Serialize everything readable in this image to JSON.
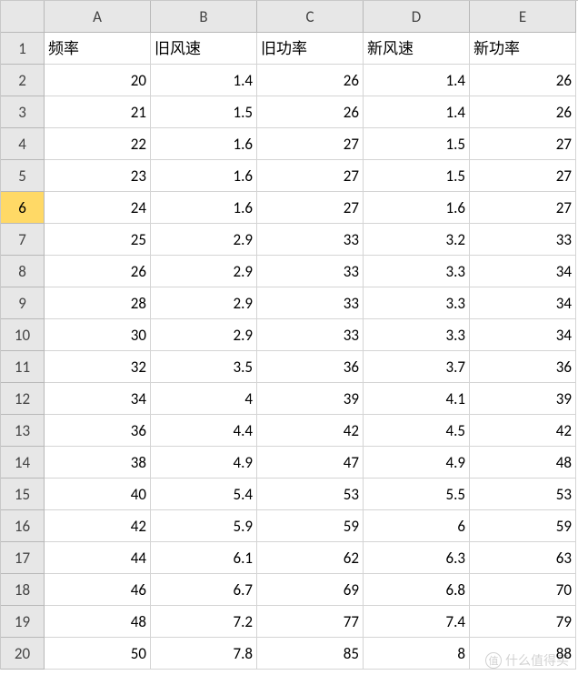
{
  "columns": [
    "A",
    "B",
    "C",
    "D",
    "E"
  ],
  "selected_row_header": 6,
  "rows": [
    {
      "n": 1,
      "cells": [
        "频率",
        "旧风速",
        "旧功率",
        "新风速",
        "新功率"
      ],
      "type": "txt"
    },
    {
      "n": 2,
      "cells": [
        "20",
        "1.4",
        "26",
        "1.4",
        "26"
      ],
      "type": "num"
    },
    {
      "n": 3,
      "cells": [
        "21",
        "1.5",
        "26",
        "1.4",
        "26"
      ],
      "type": "num"
    },
    {
      "n": 4,
      "cells": [
        "22",
        "1.6",
        "27",
        "1.5",
        "27"
      ],
      "type": "num"
    },
    {
      "n": 5,
      "cells": [
        "23",
        "1.6",
        "27",
        "1.5",
        "27"
      ],
      "type": "num"
    },
    {
      "n": 6,
      "cells": [
        "24",
        "1.6",
        "27",
        "1.6",
        "27"
      ],
      "type": "num"
    },
    {
      "n": 7,
      "cells": [
        "25",
        "2.9",
        "33",
        "3.2",
        "33"
      ],
      "type": "num"
    },
    {
      "n": 8,
      "cells": [
        "26",
        "2.9",
        "33",
        "3.3",
        "34"
      ],
      "type": "num"
    },
    {
      "n": 9,
      "cells": [
        "28",
        "2.9",
        "33",
        "3.3",
        "34"
      ],
      "type": "num"
    },
    {
      "n": 10,
      "cells": [
        "30",
        "2.9",
        "33",
        "3.3",
        "34"
      ],
      "type": "num"
    },
    {
      "n": 11,
      "cells": [
        "32",
        "3.5",
        "36",
        "3.7",
        "36"
      ],
      "type": "num"
    },
    {
      "n": 12,
      "cells": [
        "34",
        "4",
        "39",
        "4.1",
        "39"
      ],
      "type": "num"
    },
    {
      "n": 13,
      "cells": [
        "36",
        "4.4",
        "42",
        "4.5",
        "42"
      ],
      "type": "num"
    },
    {
      "n": 14,
      "cells": [
        "38",
        "4.9",
        "47",
        "4.9",
        "48"
      ],
      "type": "num"
    },
    {
      "n": 15,
      "cells": [
        "40",
        "5.4",
        "53",
        "5.5",
        "53"
      ],
      "type": "num"
    },
    {
      "n": 16,
      "cells": [
        "42",
        "5.9",
        "59",
        "6",
        "59"
      ],
      "type": "num"
    },
    {
      "n": 17,
      "cells": [
        "44",
        "6.1",
        "62",
        "6.3",
        "63"
      ],
      "type": "num"
    },
    {
      "n": 18,
      "cells": [
        "46",
        "6.7",
        "69",
        "6.8",
        "70"
      ],
      "type": "num"
    },
    {
      "n": 19,
      "cells": [
        "48",
        "7.2",
        "77",
        "7.4",
        "79"
      ],
      "type": "num"
    },
    {
      "n": 20,
      "cells": [
        "50",
        "7.8",
        "85",
        "8",
        "88"
      ],
      "type": "num"
    }
  ],
  "watermark": {
    "badge": "值",
    "text": "什么值得买"
  },
  "chart_data": {
    "type": "table",
    "title": "",
    "columns": [
      "频率",
      "旧风速",
      "旧功率",
      "新风速",
      "新功率"
    ],
    "data": [
      [
        20,
        1.4,
        26,
        1.4,
        26
      ],
      [
        21,
        1.5,
        26,
        1.4,
        26
      ],
      [
        22,
        1.6,
        27,
        1.5,
        27
      ],
      [
        23,
        1.6,
        27,
        1.5,
        27
      ],
      [
        24,
        1.6,
        27,
        1.6,
        27
      ],
      [
        25,
        2.9,
        33,
        3.2,
        33
      ],
      [
        26,
        2.9,
        33,
        3.3,
        34
      ],
      [
        28,
        2.9,
        33,
        3.3,
        34
      ],
      [
        30,
        2.9,
        33,
        3.3,
        34
      ],
      [
        32,
        3.5,
        36,
        3.7,
        36
      ],
      [
        34,
        4.0,
        39,
        4.1,
        39
      ],
      [
        36,
        4.4,
        42,
        4.5,
        42
      ],
      [
        38,
        4.9,
        47,
        4.9,
        48
      ],
      [
        40,
        5.4,
        53,
        5.5,
        53
      ],
      [
        42,
        5.9,
        59,
        6.0,
        59
      ],
      [
        44,
        6.1,
        62,
        6.3,
        63
      ],
      [
        46,
        6.7,
        69,
        6.8,
        70
      ],
      [
        48,
        7.2,
        77,
        7.4,
        79
      ],
      [
        50,
        7.8,
        85,
        8.0,
        88
      ]
    ]
  }
}
